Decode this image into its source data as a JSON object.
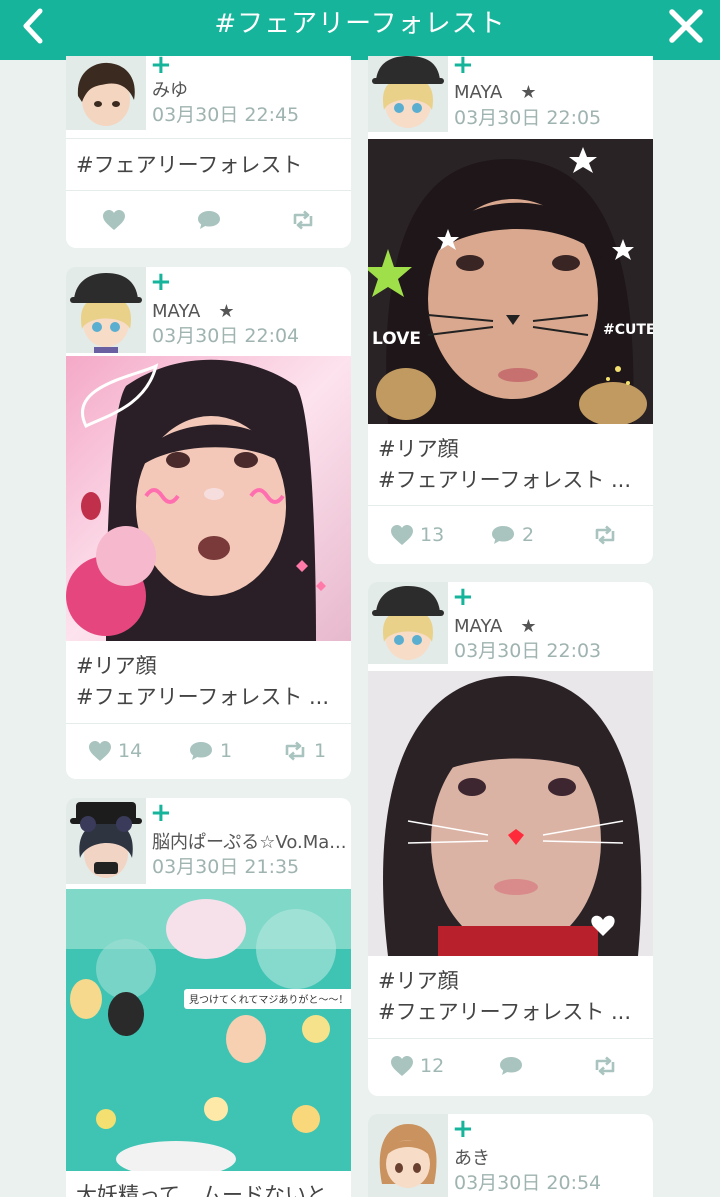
{
  "header": {
    "title": "#フェアリーフォレスト"
  },
  "colors": {
    "accent": "#17b49c",
    "background": "#eaf1ef",
    "muted": "#9fb8b3"
  },
  "posts": [
    {
      "user": "みゆ",
      "time": "03月30日 22:45",
      "caption1": "#フェアリーフォレスト",
      "caption2": "",
      "likes": "",
      "comments": "",
      "reposts": ""
    },
    {
      "user": "MAYA　★",
      "time": "03月30日 22:04",
      "caption1": "#リア顔",
      "caption2": "#フェアリーフォレスト ...",
      "likes": "14",
      "comments": "1",
      "reposts": "1"
    },
    {
      "user": "脳内ぱーぷる☆Vo.Ma...",
      "time": "03月30日 21:35",
      "caption1": "大妖精って　ムードないと...",
      "bubble": "見つけてくれてマジありがと〜〜！"
    },
    {
      "user": "MAYA　★",
      "time": "03月30日 22:05",
      "caption1": "#リア顔",
      "caption2": "#フェアリーフォレスト ...",
      "likes": "13",
      "comments": "2",
      "reposts": "",
      "stickers": {
        "love": "LOVE",
        "cute": "#CUTE"
      }
    },
    {
      "user": "MAYA　★",
      "time": "03月30日 22:03",
      "caption1": "#リア顔",
      "caption2": "#フェアリーフォレスト ...",
      "likes": "12",
      "comments": "",
      "reposts": ""
    },
    {
      "user": "あき",
      "time": "03月30日 20:54"
    }
  ]
}
